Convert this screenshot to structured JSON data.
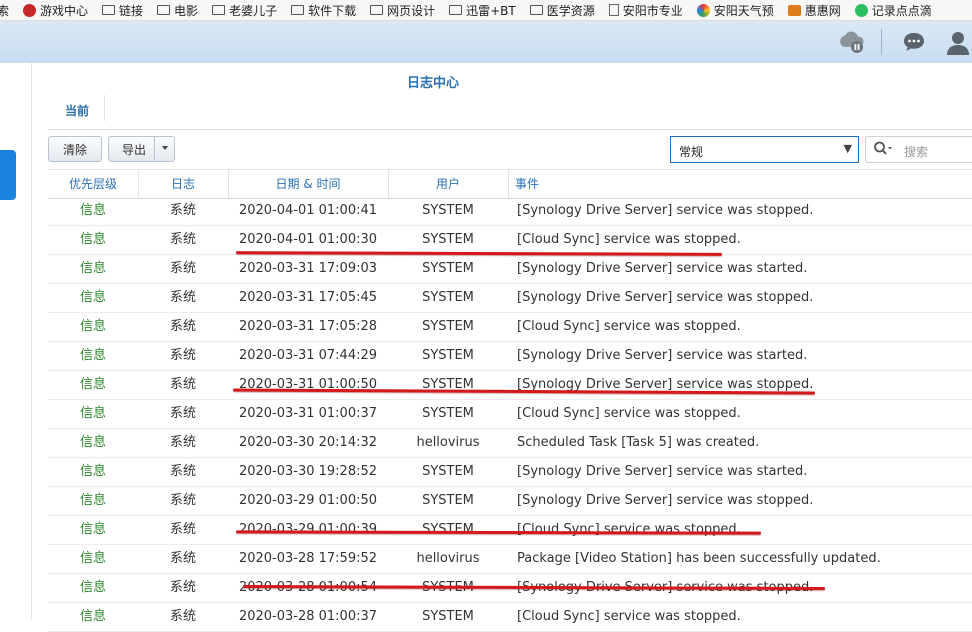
{
  "bookmarks": [
    {
      "label": "索",
      "icon": "none"
    },
    {
      "label": "游戏中心",
      "icon": "game-center-icon"
    },
    {
      "label": "链接",
      "icon": "folder-icon"
    },
    {
      "label": "电影",
      "icon": "folder-icon"
    },
    {
      "label": "老婆儿子",
      "icon": "folder-icon"
    },
    {
      "label": "软件下载",
      "icon": "folder-icon"
    },
    {
      "label": "网页设计",
      "icon": "folder-icon"
    },
    {
      "label": "迅雷+BT",
      "icon": "folder-icon"
    },
    {
      "label": "医学资源",
      "icon": "folder-icon"
    },
    {
      "label": "安阳市专业",
      "icon": "page-icon"
    },
    {
      "label": "安阳天气预",
      "icon": "weather-icon"
    },
    {
      "label": "惠惠网",
      "icon": "huihui-icon"
    },
    {
      "label": "记录点点滴",
      "icon": "evernote-icon"
    }
  ],
  "app": {
    "title": "日志中心",
    "help": "?"
  },
  "tabs": [
    {
      "label": "当前"
    }
  ],
  "toolbar": {
    "clear_label": "清除",
    "export_label": "导出",
    "filter_value": "常规",
    "search_placeholder": "搜索"
  },
  "columns": [
    {
      "label": "优先层级"
    },
    {
      "label": "日志"
    },
    {
      "label": "日期 & 时间"
    },
    {
      "label": "用户"
    },
    {
      "label": "事件"
    }
  ],
  "rows": [
    {
      "priority": "信息",
      "log": "系统",
      "time": "2020-04-01 01:00:41",
      "user": "SYSTEM",
      "event": "[Synology Drive Server] service was stopped."
    },
    {
      "priority": "信息",
      "log": "系统",
      "time": "2020-04-01 01:00:30",
      "user": "SYSTEM",
      "event": "[Cloud Sync] service was stopped."
    },
    {
      "priority": "信息",
      "log": "系统",
      "time": "2020-03-31 17:09:03",
      "user": "SYSTEM",
      "event": "[Synology Drive Server] service was started."
    },
    {
      "priority": "信息",
      "log": "系统",
      "time": "2020-03-31 17:05:45",
      "user": "SYSTEM",
      "event": "[Synology Drive Server] service was stopped."
    },
    {
      "priority": "信息",
      "log": "系统",
      "time": "2020-03-31 17:05:28",
      "user": "SYSTEM",
      "event": "[Cloud Sync] service was stopped."
    },
    {
      "priority": "信息",
      "log": "系统",
      "time": "2020-03-31 07:44:29",
      "user": "SYSTEM",
      "event": "[Synology Drive Server] service was started."
    },
    {
      "priority": "信息",
      "log": "系统",
      "time": "2020-03-31 01:00:50",
      "user": "SYSTEM",
      "event": "[Synology Drive Server] service was stopped."
    },
    {
      "priority": "信息",
      "log": "系统",
      "time": "2020-03-31 01:00:37",
      "user": "SYSTEM",
      "event": "[Cloud Sync] service was stopped."
    },
    {
      "priority": "信息",
      "log": "系统",
      "time": "2020-03-30 20:14:32",
      "user": "hellovirus",
      "event": "Scheduled Task [Task 5] was created."
    },
    {
      "priority": "信息",
      "log": "系统",
      "time": "2020-03-30 19:28:52",
      "user": "SYSTEM",
      "event": "[Synology Drive Server] service was started."
    },
    {
      "priority": "信息",
      "log": "系统",
      "time": "2020-03-29 01:00:50",
      "user": "SYSTEM",
      "event": "[Synology Drive Server] service was stopped."
    },
    {
      "priority": "信息",
      "log": "系统",
      "time": "2020-03-29 01:00:39",
      "user": "SYSTEM",
      "event": "[Cloud Sync] service was stopped."
    },
    {
      "priority": "信息",
      "log": "系统",
      "time": "2020-03-28 17:59:52",
      "user": "hellovirus",
      "event": "Package [Video Station] has been successfully updated."
    },
    {
      "priority": "信息",
      "log": "系统",
      "time": "2020-03-28 01:00:54",
      "user": "SYSTEM",
      "event": "[Synology Drive Server] service was stopped."
    },
    {
      "priority": "信息",
      "log": "系统",
      "time": "2020-03-28 01:00:37",
      "user": "SYSTEM",
      "event": "[Cloud Sync] service was stopped."
    }
  ],
  "colors": {
    "accent": "#2a72b5",
    "priority_info": "#2c8a2c",
    "annotation_red": "#d3191c"
  }
}
